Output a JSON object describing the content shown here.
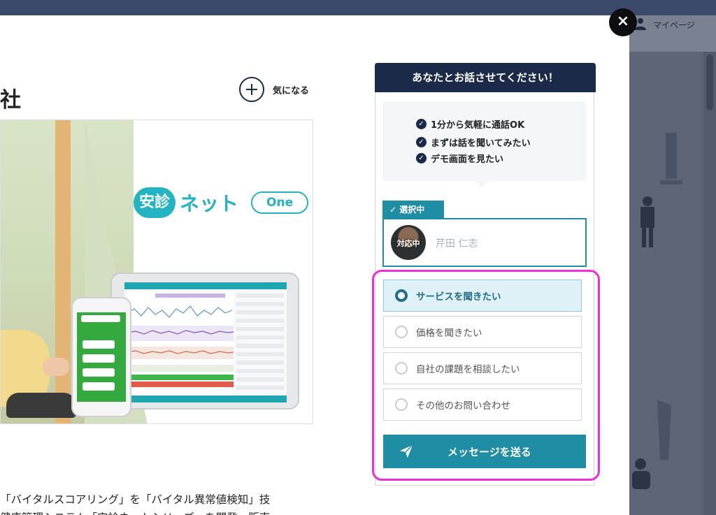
{
  "background": {
    "header_link_label": "マイページ"
  },
  "modal": {
    "company_title_partial": "社",
    "favorite_label": "気になる",
    "product_logo": {
      "badge": "安診",
      "name": "ネット",
      "edition": "One"
    },
    "description_lines": [
      "「バイタルスコアリング」を「バイタル異常値検知」技",
      "健康管理システム「安診ネットシリーズ」を開発・販売"
    ]
  },
  "contact": {
    "header": "あなたとお話させてください！",
    "checklist": [
      "1分から気軽に通話OK",
      "まずは話を聞いてみたい",
      "デモ画面を見たい"
    ],
    "selected_tab": "✓ 選択中",
    "agent": {
      "badge": "対応中",
      "name": "芹田 仁志"
    },
    "options": [
      {
        "label": "サービスを聞きたい",
        "selected": true
      },
      {
        "label": "価格を聞きたい",
        "selected": false
      },
      {
        "label": "自社の課題を相談したい",
        "selected": false
      },
      {
        "label": "その他のお問い合わせ",
        "selected": false
      }
    ],
    "send_label": "メッセージを送る"
  },
  "colors": {
    "navy": "#1b2a48",
    "teal": "#1f8da3",
    "brand": "#23b3c3",
    "highlight": "#ee2fd6"
  }
}
